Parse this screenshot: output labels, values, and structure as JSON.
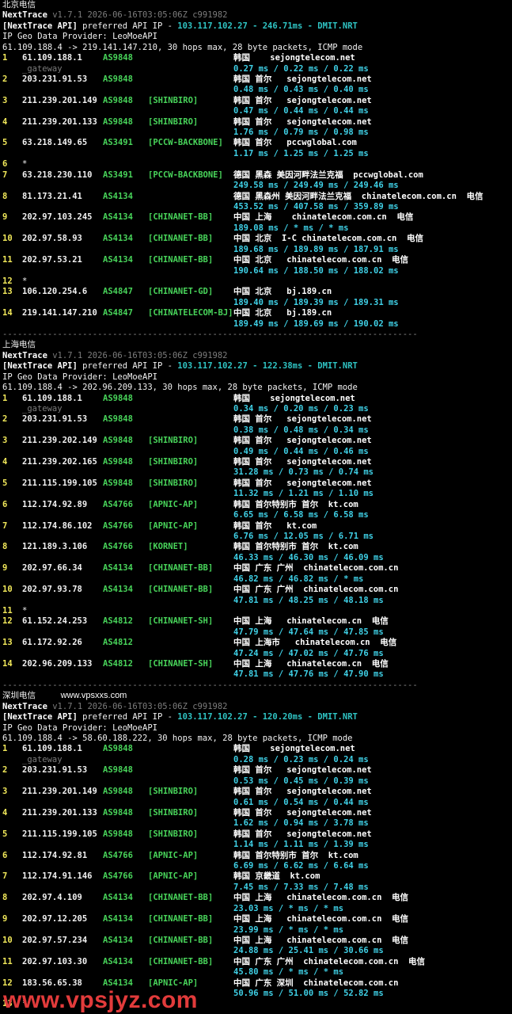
{
  "sections": [
    {
      "title": "北京电信",
      "brand": "NextTrace",
      "version": "v1.7.1 2026-06-16T03:05:06Z c991982",
      "api_prefix": "[NextTrace API]",
      "api_text": " preferred API IP - ",
      "api_ip": "103.117.102.27 - 246.71ms - DMIT.NRT",
      "geo_provider": "IP Geo Data Provider: LeoMoeAPI",
      "route": "61.109.188.4 -> 219.141.147.210, 30 hops max, 28 byte packets, ICMP mode",
      "hops": [
        {
          "n": "1",
          "ip": "61.109.188.1",
          "as": "AS9848",
          "tag": "",
          "geo": "韩国    sejongtelecom.net",
          "lat": "0.27 ms / 0.22 ms / 0.22 ms",
          "gw": "_gateway"
        },
        {
          "n": "2",
          "ip": "203.231.91.53",
          "as": "AS9848",
          "tag": "",
          "geo": "韩国 首尔   sejongtelecom.net",
          "lat": "0.48 ms / 0.43 ms / 0.40 ms"
        },
        {
          "n": "3",
          "ip": "211.239.201.149",
          "as": "AS9848",
          "tag": "[SHINBIRO]",
          "geo": "韩国 首尔   sejongtelecom.net",
          "lat": "0.47 ms / 0.44 ms / 0.44 ms"
        },
        {
          "n": "4",
          "ip": "211.239.201.133",
          "as": "AS9848",
          "tag": "[SHINBIRO]",
          "geo": "韩国 首尔   sejongtelecom.net",
          "lat": "1.76 ms / 0.79 ms / 0.98 ms"
        },
        {
          "n": "5",
          "ip": "63.218.149.65",
          "as": "AS3491",
          "tag": "[PCCW-BACKBONE]",
          "geo": "韩国 首尔   pccwglobal.com",
          "lat": "1.17 ms / 1.25 ms / 1.25 ms"
        },
        {
          "n": "6",
          "star": "*"
        },
        {
          "n": "7",
          "ip": "63.218.230.110",
          "as": "AS3491",
          "tag": "[PCCW-BACKBONE]",
          "geo": "德国 黑森 美因河畔法兰克福  pccwglobal.com",
          "lat": "249.58 ms / 249.49 ms / 249.46 ms"
        },
        {
          "n": "8",
          "ip": "81.173.21.41",
          "as": "AS4134",
          "tag": "",
          "geo": "德国 黑森州 美因河畔法兰克福  chinatelecom.com.cn  电信",
          "lat": "453.52 ms / 407.58 ms / 359.89 ms"
        },
        {
          "n": "9",
          "ip": "202.97.103.245",
          "as": "AS4134",
          "tag": "[CHINANET-BB]",
          "geo": "中国 上海    chinatelecom.com.cn  电信",
          "lat": "189.08 ms / * ms / * ms"
        },
        {
          "n": "10",
          "ip": "202.97.58.93",
          "as": "AS4134",
          "tag": "[CHINANET-BB]",
          "geo": "中国 北京  I-C chinatelecom.com.cn  电信",
          "lat": "189.68 ms / 189.89 ms / 187.91 ms"
        },
        {
          "n": "11",
          "ip": "202.97.53.21",
          "as": "AS4134",
          "tag": "[CHINANET-BB]",
          "geo": "中国 北京   chinatelecom.com.cn  电信",
          "lat": "190.64 ms / 188.50 ms / 188.02 ms"
        },
        {
          "n": "12",
          "star": "*"
        },
        {
          "n": "13",
          "ip": "106.120.254.6",
          "as": "AS4847",
          "tag": "[CHINANET-GD]",
          "geo": "中国 北京   bj.189.cn",
          "lat": "189.40 ms / 189.39 ms / 189.31 ms"
        },
        {
          "n": "14",
          "ip": "219.141.147.210",
          "as": "AS4847",
          "tag": "[CHINATELECOM-BJ]",
          "geo": "中国 北京   bj.189.cn",
          "lat": "189.49 ms / 189.69 ms / 190.02 ms"
        }
      ]
    },
    {
      "title": "上海电信",
      "brand": "NextTrace",
      "version": "v1.7.1 2026-06-16T03:05:06Z c991982",
      "api_prefix": "[NextTrace API]",
      "api_text": " preferred API IP - ",
      "api_ip": "103.117.102.27 - 122.38ms - DMIT.NRT",
      "geo_provider": "IP Geo Data Provider: LeoMoeAPI",
      "route": "61.109.188.4 -> 202.96.209.133, 30 hops max, 28 byte packets, ICMP mode",
      "hops": [
        {
          "n": "1",
          "ip": "61.109.188.1",
          "as": "AS9848",
          "tag": "",
          "geo": "韩国    sejongtelecom.net",
          "lat": "0.34 ms / 0.20 ms / 0.23 ms",
          "gw": "_gateway"
        },
        {
          "n": "2",
          "ip": "203.231.91.53",
          "as": "AS9848",
          "tag": "",
          "geo": "韩国 首尔   sejongtelecom.net",
          "lat": "0.38 ms / 0.48 ms / 0.34 ms"
        },
        {
          "n": "3",
          "ip": "211.239.202.149",
          "as": "AS9848",
          "tag": "[SHINBIRO]",
          "geo": "韩国 首尔   sejongtelecom.net",
          "lat": "0.49 ms / 0.44 ms / 0.46 ms"
        },
        {
          "n": "4",
          "ip": "211.239.202.165",
          "as": "AS9848",
          "tag": "[SHINBIRO]",
          "geo": "韩国 首尔   sejongtelecom.net",
          "lat": "31.28 ms / 0.73 ms / 0.74 ms"
        },
        {
          "n": "5",
          "ip": "211.115.199.105",
          "as": "AS9848",
          "tag": "[SHINBIRO]",
          "geo": "韩国 首尔   sejongtelecom.net",
          "lat": "11.32 ms / 1.21 ms / 1.10 ms"
        },
        {
          "n": "6",
          "ip": "112.174.92.89",
          "as": "AS4766",
          "tag": "[APNIC-AP]",
          "geo": "韩国 首尔特别市 首尔  kt.com",
          "lat": "6.65 ms / 6.58 ms / 6.58 ms"
        },
        {
          "n": "7",
          "ip": "112.174.86.102",
          "as": "AS4766",
          "tag": "[APNIC-AP]",
          "geo": "韩国 首尔   kt.com",
          "lat": "6.76 ms / 12.05 ms / 6.71 ms"
        },
        {
          "n": "8",
          "ip": "121.189.3.106",
          "as": "AS4766",
          "tag": "[KORNET]",
          "geo": "韩国 首尔特别市 首尔  kt.com",
          "lat": "46.33 ms / 46.30 ms / 46.09 ms"
        },
        {
          "n": "9",
          "ip": "202.97.66.34",
          "as": "AS4134",
          "tag": "[CHINANET-BB]",
          "geo": "中国 广东 广州  chinatelecom.com.cn",
          "lat": "46.82 ms / 46.82 ms / * ms"
        },
        {
          "n": "10",
          "ip": "202.97.93.78",
          "as": "AS4134",
          "tag": "[CHINANET-BB]",
          "geo": "中国 广东 广州  chinatelecom.com.cn",
          "lat": "47.81 ms / 48.25 ms / 48.18 ms"
        },
        {
          "n": "11",
          "star": "*"
        },
        {
          "n": "12",
          "ip": "61.152.24.253",
          "as": "AS4812",
          "tag": "[CHINANET-SH]",
          "geo": "中国 上海   chinatelecom.cn  电信",
          "lat": "47.79 ms / 47.64 ms / 47.85 ms"
        },
        {
          "n": "13",
          "ip": "61.172.92.26",
          "as": "AS4812",
          "tag": "",
          "geo": "中国 上海市   chinatelecom.cn  电信",
          "lat": "47.24 ms / 47.02 ms / 47.76 ms"
        },
        {
          "n": "14",
          "ip": "202.96.209.133",
          "as": "AS4812",
          "tag": "[CHINANET-SH]",
          "geo": "中国 上海   chinatelecom.cn  电信",
          "lat": "47.81 ms / 47.76 ms / 47.90 ms"
        }
      ]
    },
    {
      "title": "深圳电信",
      "watermark": "www.vpsxxs.com",
      "brand": "NextTrace",
      "version": "v1.7.1 2026-06-16T03:05:06Z c991982",
      "api_prefix": "[NextTrace API]",
      "api_text": " preferred API IP - ",
      "api_ip": "103.117.102.27 - 120.20ms - DMIT.NRT",
      "geo_provider": "IP Geo Data Provider: LeoMoeAPI",
      "route": "61.109.188.4 -> 58.60.188.222, 30 hops max, 28 byte packets, ICMP mode",
      "hops": [
        {
          "n": "1",
          "ip": "61.109.188.1",
          "as": "AS9848",
          "tag": "",
          "geo": "韩国    sejongtelecom.net",
          "lat": "0.28 ms / 0.23 ms / 0.24 ms",
          "gw": "_gateway"
        },
        {
          "n": "2",
          "ip": "203.231.91.53",
          "as": "AS9848",
          "tag": "",
          "geo": "韩国 首尔   sejongtelecom.net",
          "lat": "0.53 ms / 0.45 ms / 0.39 ms"
        },
        {
          "n": "3",
          "ip": "211.239.201.149",
          "as": "AS9848",
          "tag": "[SHINBIRO]",
          "geo": "韩国 首尔   sejongtelecom.net",
          "lat": "0.61 ms / 0.54 ms / 0.44 ms"
        },
        {
          "n": "4",
          "ip": "211.239.201.133",
          "as": "AS9848",
          "tag": "[SHINBIRO]",
          "geo": "韩国 首尔   sejongtelecom.net",
          "lat": "1.62 ms / 0.94 ms / 3.78 ms"
        },
        {
          "n": "5",
          "ip": "211.115.199.105",
          "as": "AS9848",
          "tag": "[SHINBIRO]",
          "geo": "韩国 首尔   sejongtelecom.net",
          "lat": "1.14 ms / 1.11 ms / 1.39 ms"
        },
        {
          "n": "6",
          "ip": "112.174.92.81",
          "as": "AS4766",
          "tag": "[APNIC-AP]",
          "geo": "韩国 首尔特别市 首尔  kt.com",
          "lat": "6.69 ms / 6.62 ms / 6.64 ms"
        },
        {
          "n": "7",
          "ip": "112.174.91.146",
          "as": "AS4766",
          "tag": "[APNIC-AP]",
          "geo": "韩国 京畿道  kt.com",
          "lat": "7.45 ms / 7.33 ms / 7.48 ms"
        },
        {
          "n": "8",
          "ip": "202.97.4.109",
          "as": "AS4134",
          "tag": "[CHINANET-BB]",
          "geo": "中国 上海   chinatelecom.com.cn  电信",
          "lat": "23.03 ms / * ms / * ms"
        },
        {
          "n": "9",
          "ip": "202.97.12.205",
          "as": "AS4134",
          "tag": "[CHINANET-BB]",
          "geo": "中国 上海   chinatelecom.com.cn  电信",
          "lat": "23.99 ms / * ms / * ms"
        },
        {
          "n": "10",
          "ip": "202.97.57.234",
          "as": "AS4134",
          "tag": "[CHINANET-BB]",
          "geo": "中国 上海   chinatelecom.com.cn  电信",
          "lat": "24.88 ms / 25.41 ms / 30.66 ms"
        },
        {
          "n": "11",
          "ip": "202.97.103.30",
          "as": "AS4134",
          "tag": "[CHINANET-BB]",
          "geo": "中国 广东 广州  chinatelecom.com.cn  电信",
          "lat": "45.80 ms / * ms / * ms"
        },
        {
          "n": "12",
          "ip": "183.56.65.38",
          "as": "AS4134",
          "tag": "[APNIC-AP]",
          "geo": "中国 广东 深圳  chinatelecom.com.cn",
          "lat": "50.96 ms / 51.00 ms / 52.82 ms"
        },
        {
          "n": "13",
          "star": "*"
        }
      ]
    }
  ],
  "separator": "-----------------------------------------------------------------------------------",
  "bottom_watermark": "www.vpsjyz.com",
  "colors": {
    "background": "#000000",
    "ip": "#f2f2f2",
    "as": "#48d45a",
    "latency": "#3fd0e6",
    "hop_number": "#f1e85a",
    "watermark": "#e23b3b"
  }
}
